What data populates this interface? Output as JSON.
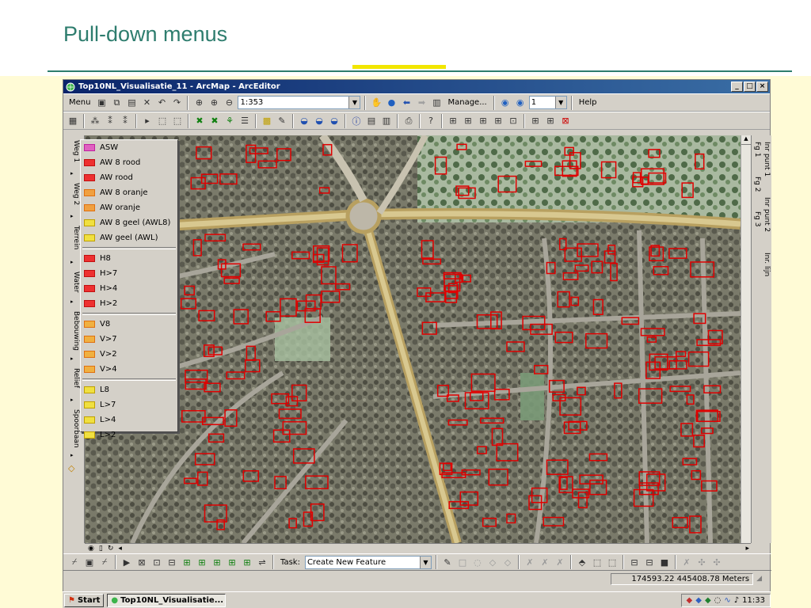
{
  "slide": {
    "title": "Pull-down menus"
  },
  "window": {
    "title": "Top10NL_Visualisatie_11 - ArcMap - ArcEditor",
    "buttons": [
      "_",
      "□",
      "×"
    ]
  },
  "toolbar1": {
    "menu_label": "Menu",
    "scale_value": "1:353",
    "manage_label": "Manage...",
    "page_value": "1",
    "help_label": "Help"
  },
  "left_tabs": [
    {
      "label": "Weg 1"
    },
    {
      "label": "Weg 2"
    },
    {
      "label": "Terrein"
    },
    {
      "label": "Water"
    },
    {
      "label": "Bebouwing"
    },
    {
      "label": "Relief"
    },
    {
      "label": "Spoorbaan"
    }
  ],
  "right_tabs": [
    {
      "label": "Fg 1"
    },
    {
      "label": "Fg 2"
    },
    {
      "label": "Fg 3"
    },
    {
      "label": "Inr punt 1"
    },
    {
      "label": "Inr punt 2"
    },
    {
      "label": "Inr. lijn"
    }
  ],
  "menu": {
    "groups": [
      [
        {
          "label": "ASW",
          "color": "#c020a0",
          "fill": "#e060c0"
        },
        {
          "label": "AW 8 rood",
          "color": "#c01010",
          "fill": "#ee3030"
        },
        {
          "label": "AW rood",
          "color": "#c01010",
          "fill": "#ee3030"
        },
        {
          "label": "AW 8 oranje",
          "color": "#e07010",
          "fill": "#f0a040"
        },
        {
          "label": "AW oranje",
          "color": "#e07010",
          "fill": "#f0a040"
        },
        {
          "label": "AW 8 geel (AWL8)",
          "color": "#c0a000",
          "fill": "#f0e040"
        },
        {
          "label": "AW geel (AWL)",
          "color": "#c0a000",
          "fill": "#f0e040"
        }
      ],
      [
        {
          "label": "H8",
          "color": "#c01010",
          "fill": "#ee3030"
        },
        {
          "label": "H>7",
          "color": "#c01010",
          "fill": "#ee3030"
        },
        {
          "label": "H>4",
          "color": "#c01010",
          "fill": "#ee3030"
        },
        {
          "label": "H>2",
          "color": "#c01010",
          "fill": "#ee3030"
        }
      ],
      [
        {
          "label": "V8",
          "color": "#e07010",
          "fill": "#f0b040"
        },
        {
          "label": "V>7",
          "color": "#e07010",
          "fill": "#f0b040"
        },
        {
          "label": "V>2",
          "color": "#e07010",
          "fill": "#f0b040"
        },
        {
          "label": "V>4",
          "color": "#e07010",
          "fill": "#f0b040"
        }
      ],
      [
        {
          "label": "L8",
          "color": "#c0a000",
          "fill": "#f0e040"
        },
        {
          "label": "L>7",
          "color": "#c0a000",
          "fill": "#f0e040"
        },
        {
          "label": "L>4",
          "color": "#c0a000",
          "fill": "#f0e040"
        },
        {
          "label": "L>2",
          "color": "#c0a000",
          "fill": "#f0e040"
        }
      ]
    ]
  },
  "editor_toolbar": {
    "task_label": "Task:",
    "task_value": "Create New Feature"
  },
  "status": {
    "coordinates": "174593.22  445408.78 Meters"
  },
  "taskbar": {
    "start_label": "Start",
    "task_label": "Top10NL_Visualisatie...",
    "clock": "11:33"
  },
  "colors": {
    "title_teal": "#2e7d6e",
    "accent_yellow": "#f2e600",
    "band_yellow": "#fffbd6",
    "building_red": "#e00000",
    "road_tan": "#c8b070"
  }
}
